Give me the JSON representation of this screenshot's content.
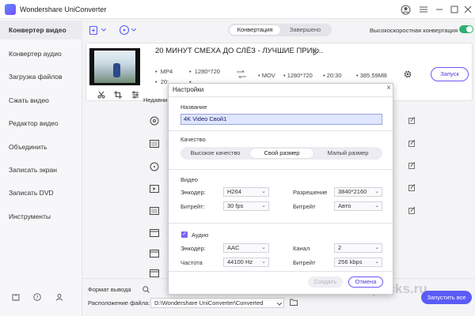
{
  "app": {
    "title": "Wondershare UniConverter"
  },
  "colors": {
    "accent": "#5b5cf6",
    "toggle_on": "#2fb171",
    "sidebar_bg": "#f7f7f9"
  },
  "sidebar": {
    "items": [
      {
        "label": "Конвертер видео",
        "active": true
      },
      {
        "label": "Конвертер аудио"
      },
      {
        "label": "Загрузка файлов"
      },
      {
        "label": "Сжать видео"
      },
      {
        "label": "Редактор видео"
      },
      {
        "label": "Объединить"
      },
      {
        "label": "Записать экран"
      },
      {
        "label": "Записать DVD"
      },
      {
        "label": "Инструменты"
      }
    ],
    "footer_icons": [
      "book-icon",
      "help-icon",
      "user-icon"
    ]
  },
  "toolbar": {
    "tabs": [
      "Конвертация",
      "Завершено"
    ],
    "active_tab": "Конвертация",
    "high_speed_label": "Высокоскоростная конвертация",
    "high_speed_on": true
  },
  "file": {
    "title": "20 МИНУТ СМЕХА ДО СЛЁЗ - ЛУЧШИЕ ПРИК...",
    "source_format": "MP4",
    "source_resolution": "1280*720",
    "source_duration": "20:...",
    "source_size": "...",
    "target_format": "MOV",
    "target_resolution": "1280*720",
    "target_duration": "20:30",
    "target_size": "385.59MB",
    "convert_label": "Запуск"
  },
  "recent_label": "Недавни",
  "bottom": {
    "format_label": "Формат вывода",
    "location_label": "Расположение файла:",
    "location_value": "D:\\Wondershare UniConverter\\Converted",
    "start_all_label": "Запустить все",
    "watermark": "Repacks.ru"
  },
  "dialog": {
    "title": "Настройки",
    "name_label": "Название",
    "name_value": "4K Video Свой1",
    "quality_label": "Качество",
    "quality_options": [
      "Высокое качество",
      "Свой размер",
      "Малый размер"
    ],
    "quality_selected": "Свой размер",
    "video_label": "Видео",
    "video": {
      "encoder_label": "Энкодер:",
      "encoder_value": "H264",
      "resolution_label": "Разрешение",
      "resolution_value": "3840*2160",
      "fps_label": "Битрейт:",
      "fps_value": "30 fps",
      "bitrate_label": "Битрейт",
      "bitrate_value": "Авто"
    },
    "audio_label": "Аудио",
    "audio_checked": true,
    "audio": {
      "encoder_label": "Энкодер:",
      "encoder_value": "AAC",
      "channel_label": "Канал",
      "channel_value": "2",
      "rate_label": "Частота",
      "rate_value": "44100 Hz",
      "bitrate_label": "Битрейт",
      "bitrate_value": "256 kbps"
    },
    "create_label": "Создать",
    "cancel_label": "Отмена"
  }
}
